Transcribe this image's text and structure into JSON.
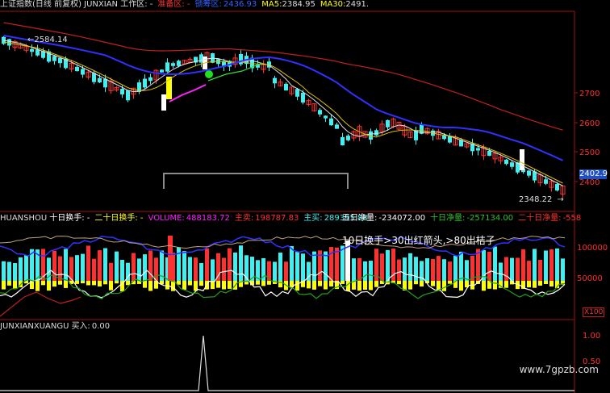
{
  "colors": {
    "up": "#ff3030",
    "down": "#40f0f0",
    "yellow": "#ffff00",
    "white": "#ffffff",
    "blue": "#2020ff",
    "green": "#30c030",
    "magenta": "#ff20ff",
    "darkred": "#c02020",
    "ma5": "#e0e0e0",
    "ma10": "#e0c000",
    "ma30": "#3030ff"
  },
  "main_header": {
    "title": "上证指数(日线 前复权) JUNXIAN 工作区: -",
    "ready_label": "准备区: -",
    "lock_label": "锁筹区:",
    "lock_value": "2436.93",
    "ma5_label": "MA5:",
    "ma5_value": "2384.95",
    "ma30_label": "MA30:",
    "ma30_value": "2491."
  },
  "price_axis": {
    "ticks": [
      "2700",
      "2600",
      "2500",
      "2400"
    ],
    "current": "2402.9",
    "high_label": "2584.14",
    "low_label": "2348.22"
  },
  "mid_header": {
    "name": "HUANSHOU",
    "ten_day": "十日换手: -",
    "twenty_day": "二十日换手: -",
    "volume_label": "VOLUME:",
    "volume_value": "488183.72",
    "main_sell_label": "主卖:",
    "main_sell_value": "198787.83",
    "main_buy_label": "主买:",
    "main_buy_value": "289395.88"
  },
  "mid_header_right": {
    "five_day_label": "五日净量:",
    "five_day_value": "-234072.00",
    "ten_day_label": "十日净量:",
    "ten_day_value": "-257134.00",
    "twenty_day_label": "二十日净量:",
    "twenty_day_value": "-558"
  },
  "annotation": "10日换手>30出红箭头,>80出桔子",
  "mid_axis": {
    "ticks": [
      "100000",
      "50000"
    ],
    "x100": "X100"
  },
  "bottom_header": {
    "name": "JUNXIANXUANGU",
    "buy_label": "买入:",
    "buy_value": "0.00"
  },
  "bottom_axis": {
    "ticks": [
      "1.00",
      "0.50"
    ]
  },
  "watermark": "www.7gpzb.com"
}
